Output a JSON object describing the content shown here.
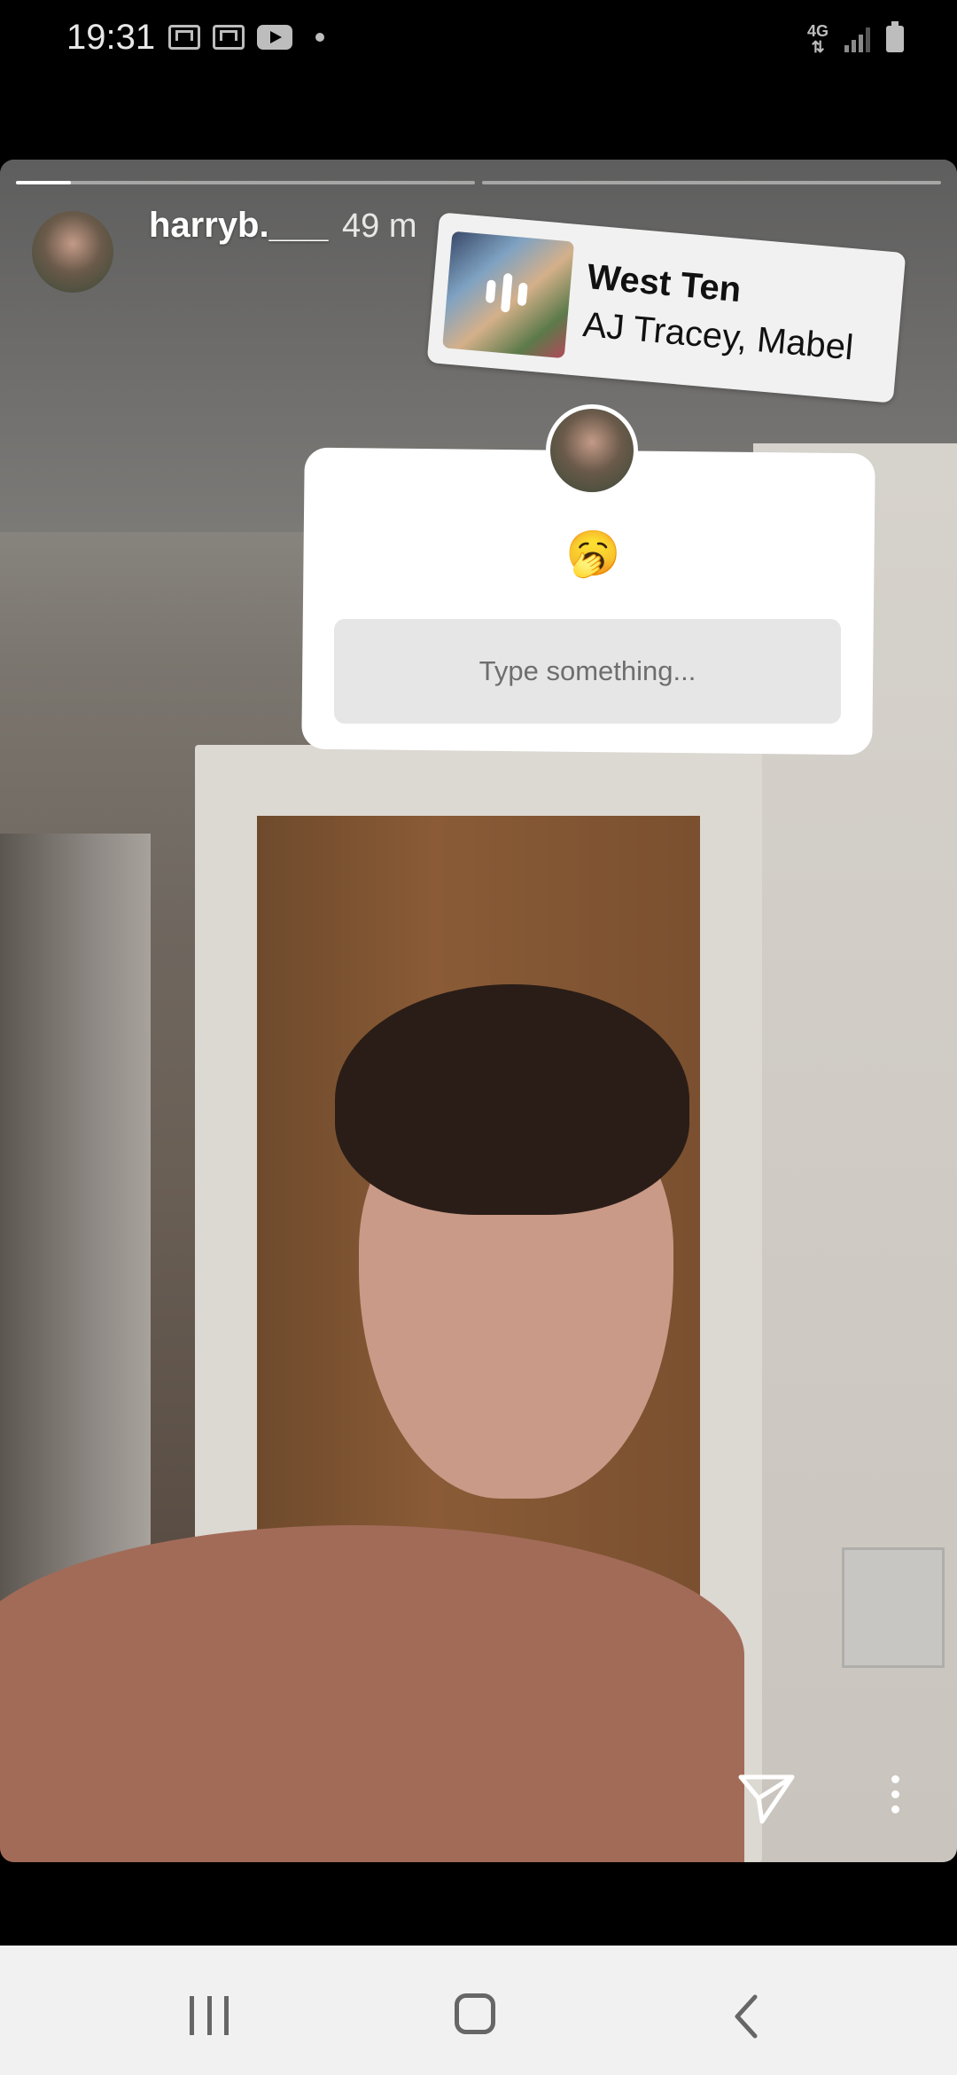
{
  "status_bar": {
    "time": "19:31",
    "left_icons": [
      "gmail-icon",
      "gmail-icon",
      "youtube-icon",
      "notification-dot-icon"
    ],
    "network": "4G",
    "right_icons": [
      "signal-icon",
      "battery-icon"
    ]
  },
  "story": {
    "progress": [
      {
        "segment": 1,
        "filled": 0.12
      },
      {
        "segment": 2,
        "filled": 0.0
      }
    ],
    "username": "harryb.___",
    "time_ago": "49 m",
    "music_sticker": {
      "title": "West Ten",
      "artist": "AJ Tracey, Mabel"
    },
    "question_sticker": {
      "emoji": "🥱",
      "placeholder": "Type something..."
    },
    "bottom_icons": [
      "send-icon",
      "more-options-icon"
    ]
  },
  "nav_bar": {
    "buttons": [
      "recent-apps-icon",
      "home-icon",
      "back-icon"
    ]
  }
}
